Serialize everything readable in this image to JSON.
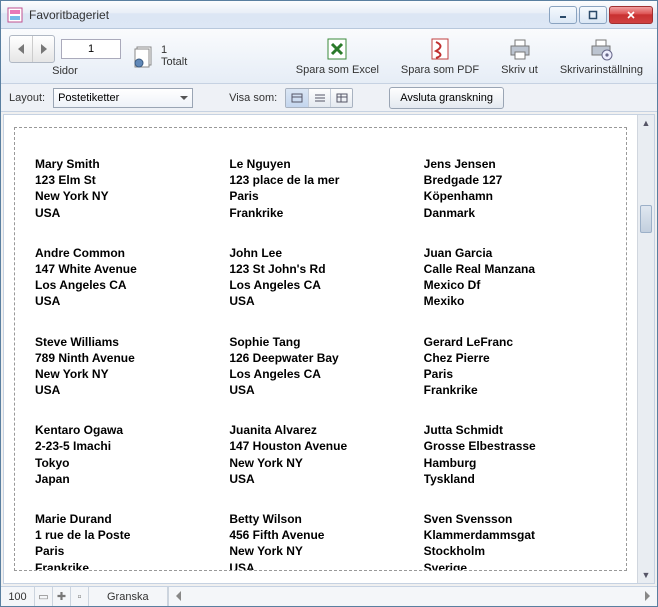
{
  "window": {
    "title": "Favoritbageriet"
  },
  "nav": {
    "page_input": "1",
    "page_caption": "Sidor",
    "total_count": "1",
    "total_label": "Totalt"
  },
  "tools": {
    "excel": "Spara som Excel",
    "pdf": "Spara som PDF",
    "print": "Skriv ut",
    "printersettings": "Skrivarinställning"
  },
  "toolbar2": {
    "layout_label": "Layout:",
    "layout_value": "Postetiketter",
    "viewas_label": "Visa som:",
    "exit_preview": "Avsluta granskning"
  },
  "addresses": [
    [
      "Mary Smith",
      "123 Elm St",
      "New York NY",
      "USA"
    ],
    [
      "Le Nguyen",
      "123 place de la mer",
      "Paris",
      "Frankrike"
    ],
    [
      "Jens Jensen",
      "Bredgade 127",
      "Köpenhamn",
      "Danmark"
    ],
    [
      "Andre Common",
      "147 White Avenue",
      "Los Angeles CA",
      "USA"
    ],
    [
      "John Lee",
      "123 St John's Rd",
      "Los Angeles CA",
      "USA"
    ],
    [
      "Juan Garcia",
      "Calle Real Manzana",
      "Mexico Df",
      "Mexiko"
    ],
    [
      "Steve Williams",
      "789 Ninth Avenue",
      "New York NY",
      "USA"
    ],
    [
      "Sophie Tang",
      "126 Deepwater Bay",
      "Los Angeles CA",
      "USA"
    ],
    [
      "Gerard LeFranc",
      "Chez Pierre",
      "Paris",
      "Frankrike"
    ],
    [
      "Kentaro Ogawa",
      "2-23-5 Imachi",
      "Tokyo",
      "Japan"
    ],
    [
      "Juanita Alvarez",
      "147 Houston Avenue",
      "New York NY",
      "USA"
    ],
    [
      "Jutta Schmidt",
      "Grosse Elbestrasse",
      "Hamburg",
      "Tyskland"
    ],
    [
      "Marie Durand",
      "1 rue de la Poste",
      "Paris",
      "Frankrike"
    ],
    [
      "Betty Wilson",
      "456 Fifth Avenue",
      "New York NY",
      "USA"
    ],
    [
      "Sven Svensson",
      "Klammerdammsgat",
      "Stockholm",
      "Sverige"
    ]
  ],
  "status": {
    "zoom": "100",
    "tab": "Granska"
  }
}
